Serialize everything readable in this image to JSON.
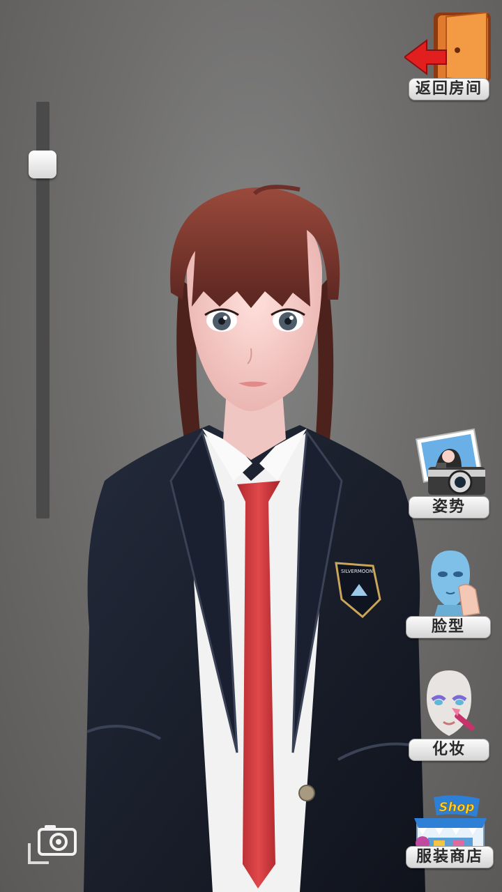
{
  "top_right": {
    "back_label": "返回房间"
  },
  "side_menu": {
    "pose_label": "姿势",
    "face_label": "脸型",
    "makeup_label": "化妆",
    "shop_label": "服装商店",
    "shop_sign": "Shop"
  },
  "slider": {
    "zoom_level": 0.85
  },
  "character": {
    "badge_text": "SILVERMOON"
  },
  "icons": {
    "back": "exit-door-icon",
    "pose": "camera-photo-icon",
    "face": "face-shape-icon",
    "makeup": "makeup-brush-icon",
    "shop": "clothing-store-icon",
    "snapshot": "screenshot-camera-icon"
  }
}
